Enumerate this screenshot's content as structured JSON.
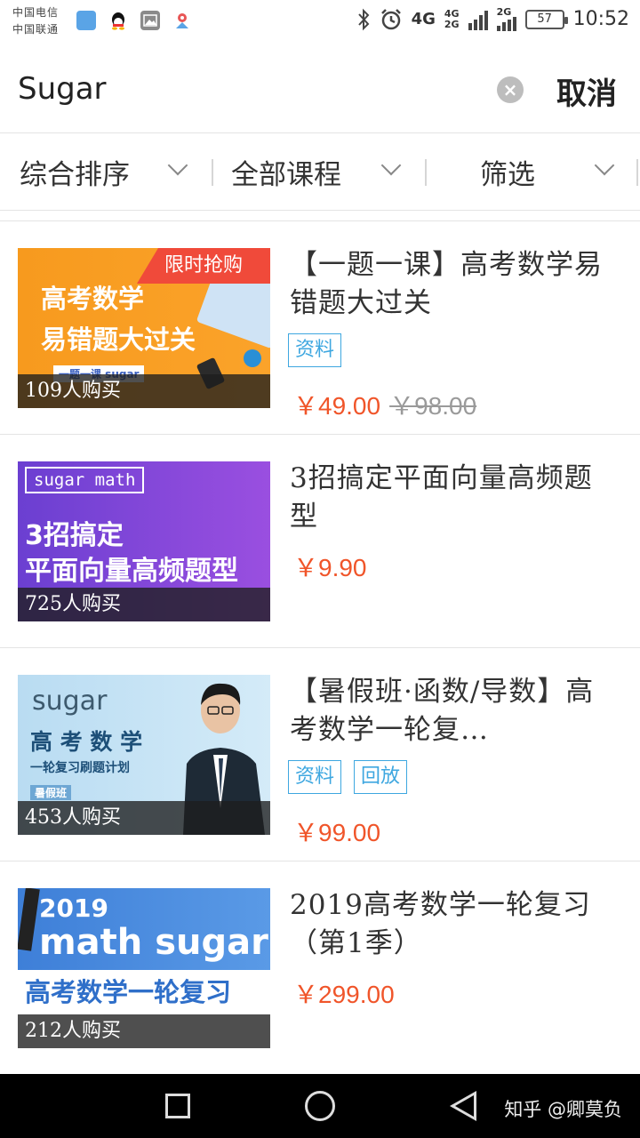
{
  "status_bar": {
    "carrier_1": "中国电信",
    "carrier_2": "中国联通",
    "network_1": "4G",
    "network_2": "4G",
    "network_3": "2G",
    "network_4": "2G",
    "battery": "57",
    "time": "10:52",
    "app_icons": [
      "health-app-icon",
      "qq-icon",
      "gallery-icon",
      "location-app-icon"
    ]
  },
  "search": {
    "value": "Sugar",
    "clear_icon": "×",
    "cancel_label": "取消"
  },
  "filters": [
    {
      "label": "综合排序"
    },
    {
      "label": "全部课程"
    },
    {
      "label": "筛选"
    }
  ],
  "courses": [
    {
      "title": "【一题一课】高考数学易错题大过关",
      "buyers": "109人购买",
      "price": "￥49.00",
      "original_price": "￥98.00",
      "tags": [
        "资料"
      ],
      "thumb": {
        "line1": "高考数学",
        "line2": "易错题大过关",
        "ribbon": "限时抢购",
        "footer": "一题一课 sugar"
      }
    },
    {
      "title": "3招搞定平面向量高频题型",
      "buyers": "725人购买",
      "price": "￥9.90",
      "tags": [],
      "thumb": {
        "badge": "sugar math",
        "line1": "3招搞定",
        "line2": "平面向量高频题型"
      }
    },
    {
      "title": "【暑假班·函数/导数】高考数学一轮复…",
      "buyers": "453人购买",
      "price": "￥99.00",
      "tags": [
        "资料",
        "回放"
      ],
      "thumb": {
        "brand": "sugar",
        "line1": "高 考 数 学",
        "line2": "一轮复习刷题计划",
        "badge": "暑假班"
      }
    },
    {
      "title": "2019高考数学一轮复习（第1季）",
      "buyers": "212人购买",
      "price": "￥299.00",
      "tags": [],
      "thumb": {
        "year": "2019",
        "brand": "math sugar",
        "line1": "高考数学一轮复习"
      }
    }
  ],
  "navbar": {
    "watermark": "知乎 @卿莫负"
  },
  "colors": {
    "price": "#f0552a",
    "tag": "#3ea7e0",
    "ribbon": "#f04a3a"
  }
}
